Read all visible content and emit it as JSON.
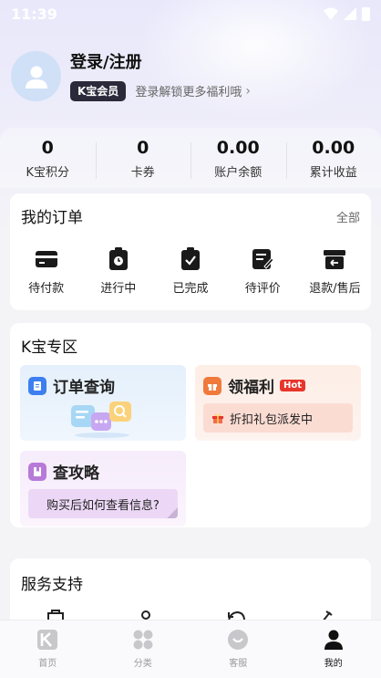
{
  "status_bar": {
    "time": "11:39"
  },
  "profile": {
    "title": "登录/注册",
    "member_badge": "K宝会员",
    "member_hint": "登录解锁更多福利哦"
  },
  "stats": [
    {
      "value": "0",
      "label": "K宝积分"
    },
    {
      "value": "0",
      "label": "卡券"
    },
    {
      "value": "0.00",
      "label": "账户余额"
    },
    {
      "value": "0.00",
      "label": "累计收益"
    }
  ],
  "orders": {
    "title": "我的订单",
    "all_label": "全部",
    "items": [
      {
        "label": "待付款",
        "icon": "wallet-icon"
      },
      {
        "label": "进行中",
        "icon": "clipboard-clock-icon"
      },
      {
        "label": "已完成",
        "icon": "clipboard-check-icon"
      },
      {
        "label": "待评价",
        "icon": "edit-note-icon"
      },
      {
        "label": "退款/售后",
        "icon": "return-box-icon"
      }
    ]
  },
  "zone": {
    "title": "K宝专区",
    "order_query": {
      "title": "订单查询"
    },
    "welfare": {
      "title": "领福利",
      "hot": "Hot",
      "banner": "折扣礼包派发中"
    },
    "guide": {
      "title": "查攻略",
      "banner": "购买后如何查看信息?"
    }
  },
  "service": {
    "title": "服务支持"
  },
  "tabbar": [
    {
      "label": "首页",
      "icon": "home-logo-icon"
    },
    {
      "label": "分类",
      "icon": "category-icon"
    },
    {
      "label": "客服",
      "icon": "customer-service-icon"
    },
    {
      "label": "我的",
      "icon": "profile-icon",
      "active": true
    }
  ],
  "colors": {
    "accent": "#3d7ff0",
    "hot": "#e8352c",
    "welfare": "#f07a3c",
    "guide": "#b77ad9"
  }
}
